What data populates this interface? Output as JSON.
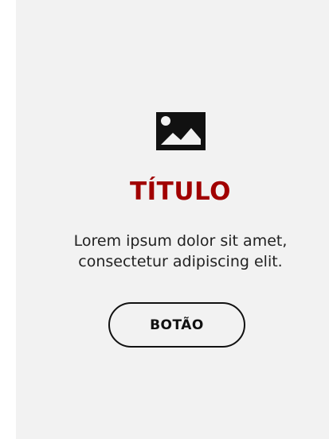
{
  "card": {
    "icon": "image-icon",
    "title": "TÍTULO",
    "description_line1": "Lorem ipsum dolor sit amet,",
    "description_line2": "consectetur adipiscing elit.",
    "button_label": "BOTÃO"
  },
  "colors": {
    "background": "#f2f2f2",
    "title": "#a10000",
    "text": "#222222",
    "button_border": "#111111"
  }
}
